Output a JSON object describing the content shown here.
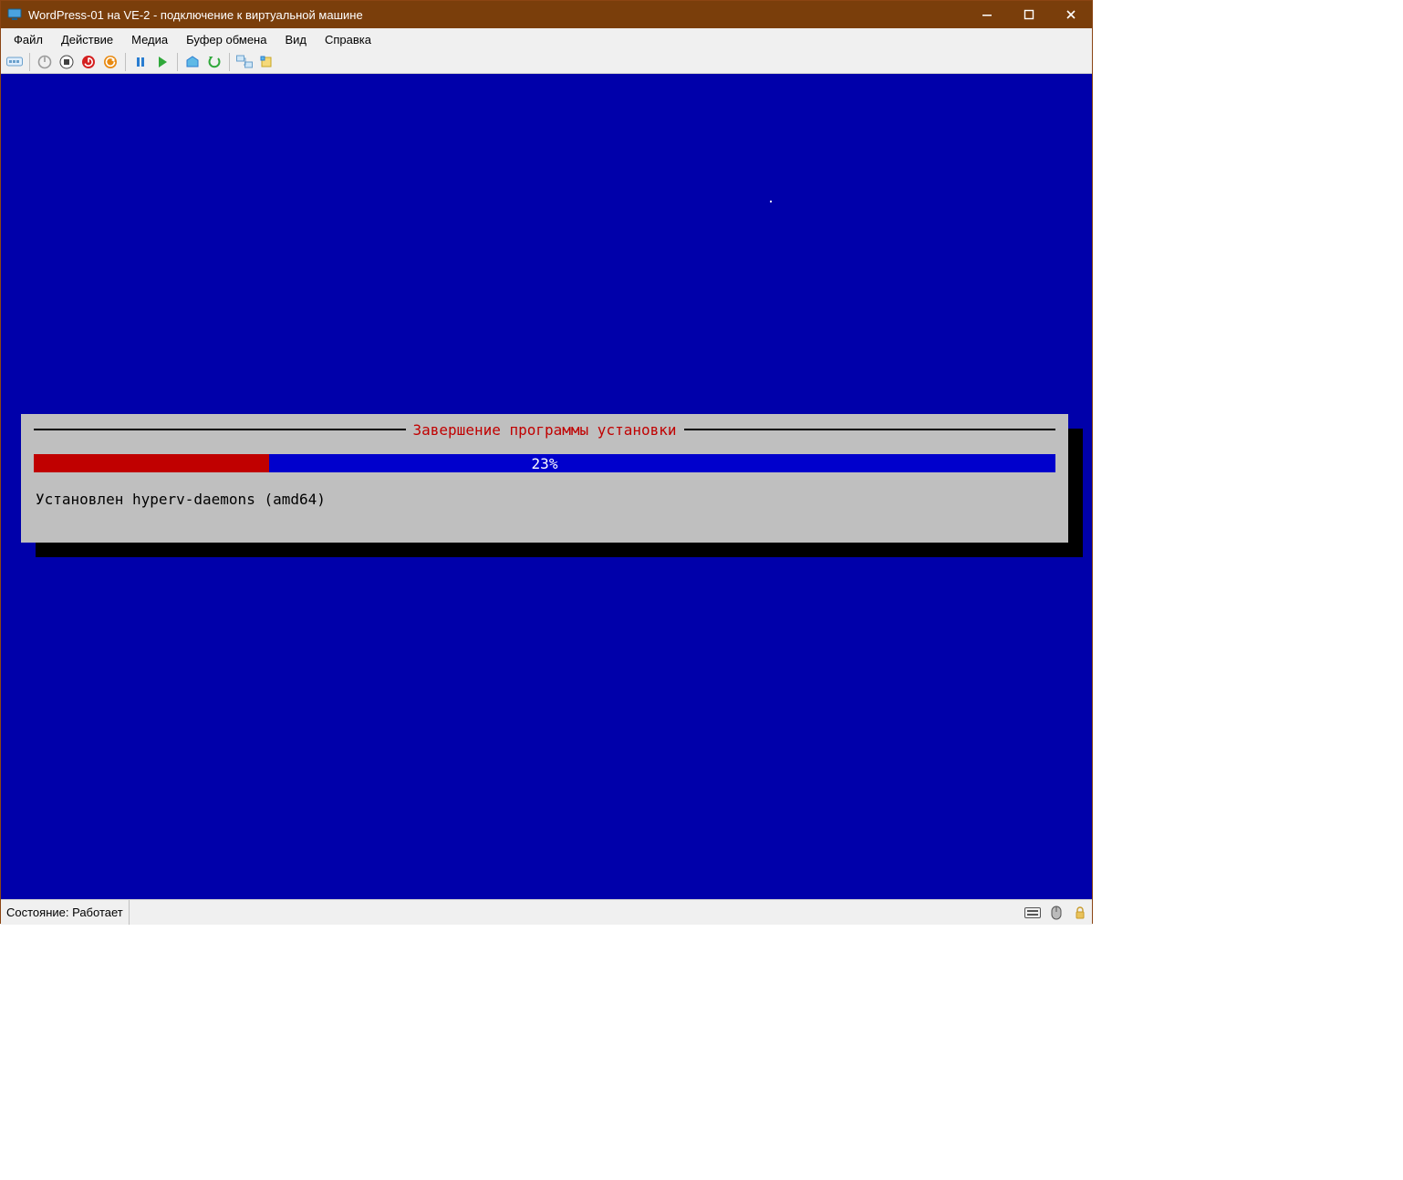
{
  "window": {
    "title": "WordPress-01 на VE-2 - подключение к виртуальной машине"
  },
  "menu": {
    "items": [
      "Файл",
      "Действие",
      "Медиа",
      "Буфер обмена",
      "Вид",
      "Справка"
    ]
  },
  "toolbar": {
    "buttons": [
      "ctrl-alt-del-icon",
      "turnoff-icon",
      "stop-icon",
      "shutdown-icon",
      "reset-icon",
      "pause-icon",
      "play-icon",
      "checkpoint-icon",
      "revert-icon",
      "enhanced-session-icon",
      "share-icon"
    ]
  },
  "installer": {
    "title": "Завершение программы установки",
    "percent": 23,
    "percent_label": "23%",
    "message": "Установлен hyperv-daemons (amd64)"
  },
  "status": {
    "text": "Состояние: Работает"
  },
  "colors": {
    "titlebar": "#7a3e0b",
    "console_bg": "#0000aa",
    "progress_fill": "#c00000",
    "progress_track": "#0000cc",
    "panel_bg": "#bfbfbf"
  }
}
